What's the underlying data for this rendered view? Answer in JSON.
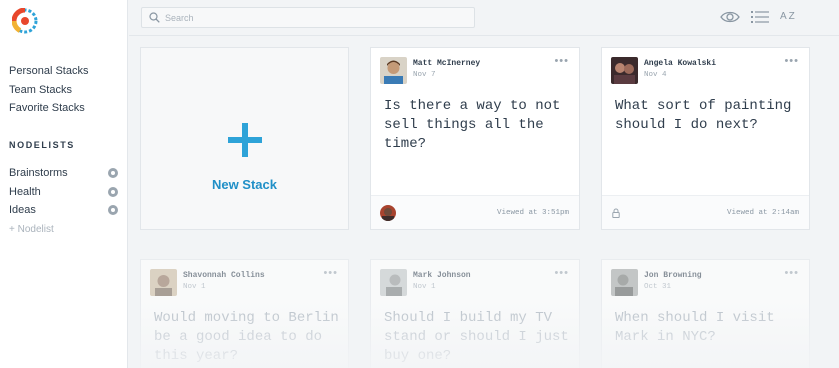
{
  "sidebar": {
    "stacks": [
      "Personal Stacks",
      "Team Stacks",
      "Favorite Stacks"
    ],
    "nodelists_title": "NODELISTS",
    "nodelists": [
      "Brainstorms",
      "Health",
      "Ideas"
    ],
    "add_nodelist": "+ Nodelist"
  },
  "search": {
    "placeholder": "Search"
  },
  "toolbar": {
    "sort_label": "AZ"
  },
  "new_stack": {
    "label": "New Stack"
  },
  "cards": [
    {
      "author": "Matt McInerney",
      "date": "Nov 7",
      "question": "Is there a way to not sell things all the time?",
      "viewed": "Viewed at 3:51pm"
    },
    {
      "author": "Angela Kowalski",
      "date": "Nov 4",
      "question": "What sort of painting should I do next?",
      "viewed": "Viewed at 2:14am"
    },
    {
      "author": "Shavonnah Collins",
      "date": "Nov 1",
      "question": "Would moving to Berlin be a good idea to do this year?"
    },
    {
      "author": "Mark Johnson",
      "date": "Nov 1",
      "question": "Should I build my TV stand or should I just buy one?"
    },
    {
      "author": "Jon Browning",
      "date": "Oct 31",
      "question": "When should I visit Mark in NYC?"
    }
  ],
  "colors": {
    "accent": "#2ea3d8",
    "accent_text": "#1f8fc7",
    "background": "#f2f4f6"
  }
}
